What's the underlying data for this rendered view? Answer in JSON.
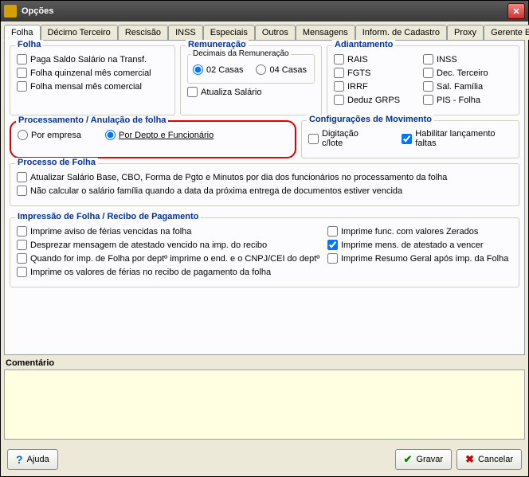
{
  "window": {
    "title": "Opções"
  },
  "tabs": [
    "Folha",
    "Décimo Terceiro",
    "Rescisão",
    "INSS",
    "Especiais",
    "Outros",
    "Mensagens",
    "Inform. de Cadastro",
    "Proxy",
    "Gerente Eletrônico"
  ],
  "folha": {
    "title": "Folha",
    "paga_saldo": "Paga Saldo Salário na Transf.",
    "quinzenal": "Folha quinzenal mês comercial",
    "mensal": "Folha mensal mês comercial"
  },
  "remun": {
    "title": "Remuneração",
    "decimais_title": "Decimais da Remuneração",
    "c02": "02 Casas",
    "c04": "04 Casas",
    "atualiza": "Atualiza Salário"
  },
  "adiant": {
    "title": "Adiantamento",
    "rais": "RAIS",
    "inss": "INSS",
    "fgts": "FGTS",
    "dec": "Dec. Terceiro",
    "irrf": "IRRF",
    "sal": "Sal. Família",
    "deduz": "Deduz GRPS",
    "pis": "PIS - Folha"
  },
  "proc": {
    "title": "Processamento / Anulação de folha",
    "empresa": "Por empresa",
    "depto": "Por Depto e Funcionário"
  },
  "conf": {
    "title": "Configurações de Movimento",
    "digit": "Digitação c/lote",
    "hab": "Habilitar lançamento faltas"
  },
  "pfolha": {
    "title": "Processo de Folha",
    "atualizar": "Atualizar Salário Base, CBO, Forma de Pgto e Minutos por dia dos funcionários no processamento da folha",
    "naocalc": "Não calcular o salário família quando a data da próxima entrega de documentos estiver vencida"
  },
  "imp": {
    "title": "Impressão de Folha / Recibo de Pagamento",
    "aviso": "Imprime aviso de férias vencidas na folha",
    "desprezar": "Desprezar mensagem de atestado vencido na imp. do recibo",
    "quando": "Quando for imp. de Folha por deptº imprime o end. e o CNPJ/CEI do deptº",
    "valores": "Imprime os valores de férias no recibo de pagamento da folha",
    "zerados": "Imprime func. com valores Zerados",
    "mens": "Imprime mens. de  atestado a vencer",
    "resumo": "Imprime Resumo Geral após imp. da Folha"
  },
  "comment_label": "Comentário",
  "buttons": {
    "ajuda": "Ajuda",
    "gravar": "Gravar",
    "cancelar": "Cancelar"
  }
}
